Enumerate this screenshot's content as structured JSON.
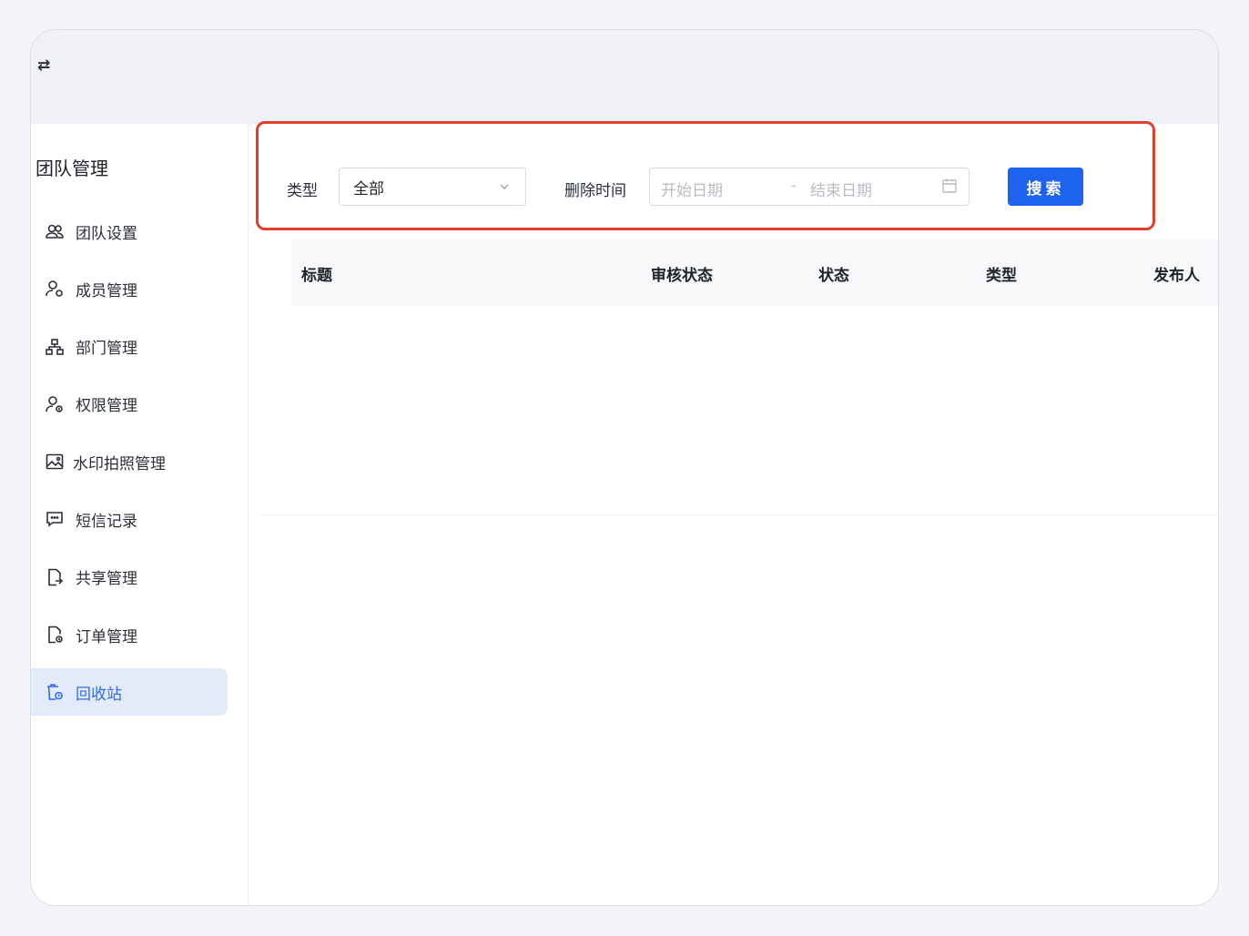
{
  "topbar": {
    "toggle_icon": "swap-arrows-icon"
  },
  "sidebar": {
    "title": "团队管理",
    "items": [
      {
        "label": "团队设置",
        "icon": "team-icon"
      },
      {
        "label": "成员管理",
        "icon": "member-icon"
      },
      {
        "label": "部门管理",
        "icon": "org-chart-icon"
      },
      {
        "label": "权限管理",
        "icon": "permission-icon"
      },
      {
        "label": "水印拍照管理",
        "icon": "watermark-photo-icon"
      },
      {
        "label": "短信记录",
        "icon": "sms-icon"
      },
      {
        "label": "共享管理",
        "icon": "share-file-icon"
      },
      {
        "label": "订单管理",
        "icon": "order-file-icon"
      },
      {
        "label": "回收站",
        "icon": "recycle-bin-icon",
        "active": true
      }
    ]
  },
  "filters": {
    "type_label": "类型",
    "type_value": "全部",
    "delete_time_label": "删除时间",
    "start_placeholder": "开始日期",
    "range_separator": "-",
    "end_placeholder": "结束日期",
    "search_button": "搜索"
  },
  "table": {
    "columns": [
      "标题",
      "审核状态",
      "状态",
      "类型",
      "发布人"
    ]
  },
  "colors": {
    "accent": "#1e62f0",
    "active_bg": "#e3ebfb",
    "highlight_border": "#e0402b"
  }
}
